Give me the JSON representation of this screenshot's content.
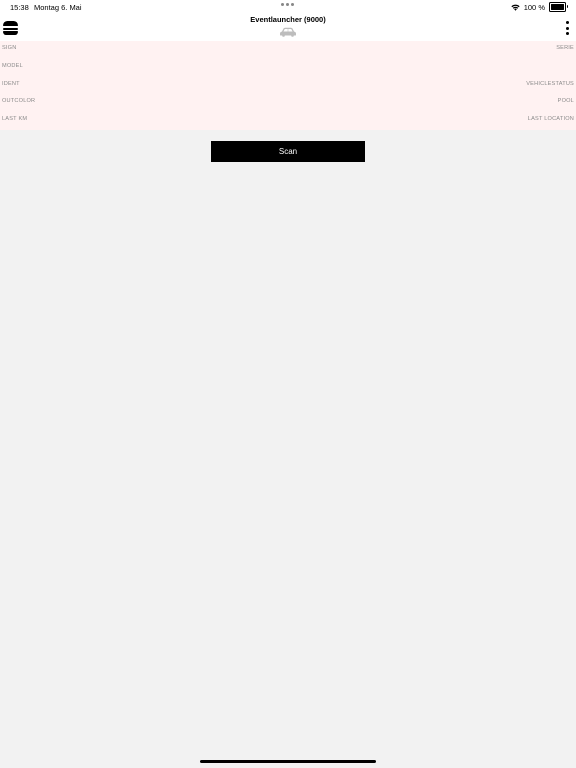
{
  "status_bar": {
    "time": "15:38",
    "date": "Montag 6. Mai",
    "battery_percent": "100 %",
    "battery_level": 1.0,
    "icons": [
      "wifi-icon",
      "battery-icon"
    ]
  },
  "nav": {
    "title": "Eventlauncher (9000)",
    "left_icon": "menu-icon",
    "center_icon": "car-icon",
    "right_icon": "more-vertical-icon"
  },
  "info_panel": {
    "rows": [
      {
        "left": "SIGN",
        "right": "SERIE"
      },
      {
        "left": "MODEL",
        "right": ""
      },
      {
        "left": "IDENT",
        "right": "VEHICLESTATUS"
      },
      {
        "left": "OUTCOLOR",
        "right": "POOL"
      },
      {
        "left": "LAST KM",
        "right": "LAST LOCATION"
      }
    ]
  },
  "scan_button": {
    "label": "Scan"
  },
  "colors": {
    "background": "#f2f2f2",
    "panel_background": "#fff2f2",
    "bar_background": "#ffffff",
    "label_text": "#8a8a8a",
    "button_background": "#000000",
    "button_text": "#ffffff"
  }
}
